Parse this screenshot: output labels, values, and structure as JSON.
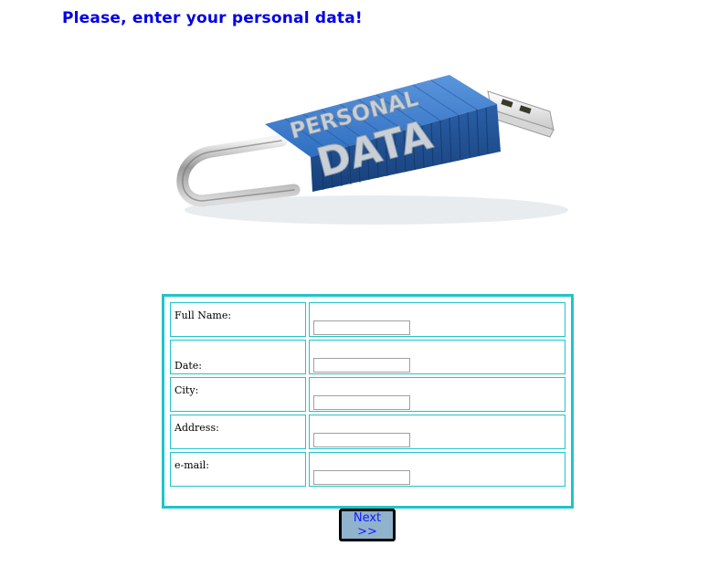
{
  "page": {
    "heading": "Please, enter your personal data!"
  },
  "hero": {
    "line1": "PERSONAL",
    "line2": "DATA",
    "accent_color": "#2f6fc1"
  },
  "form": {
    "fields": [
      {
        "label": "Full Name:",
        "value": "",
        "placeholder": ""
      },
      {
        "label": "Date:",
        "value": "",
        "placeholder": ""
      },
      {
        "label": "City:",
        "value": "",
        "placeholder": ""
      },
      {
        "label": "Address:",
        "value": "",
        "placeholder": ""
      },
      {
        "label": "e-mail:",
        "value": "",
        "placeholder": ""
      }
    ],
    "border_color": "#20c4c8",
    "submit_label": "Next >>"
  }
}
